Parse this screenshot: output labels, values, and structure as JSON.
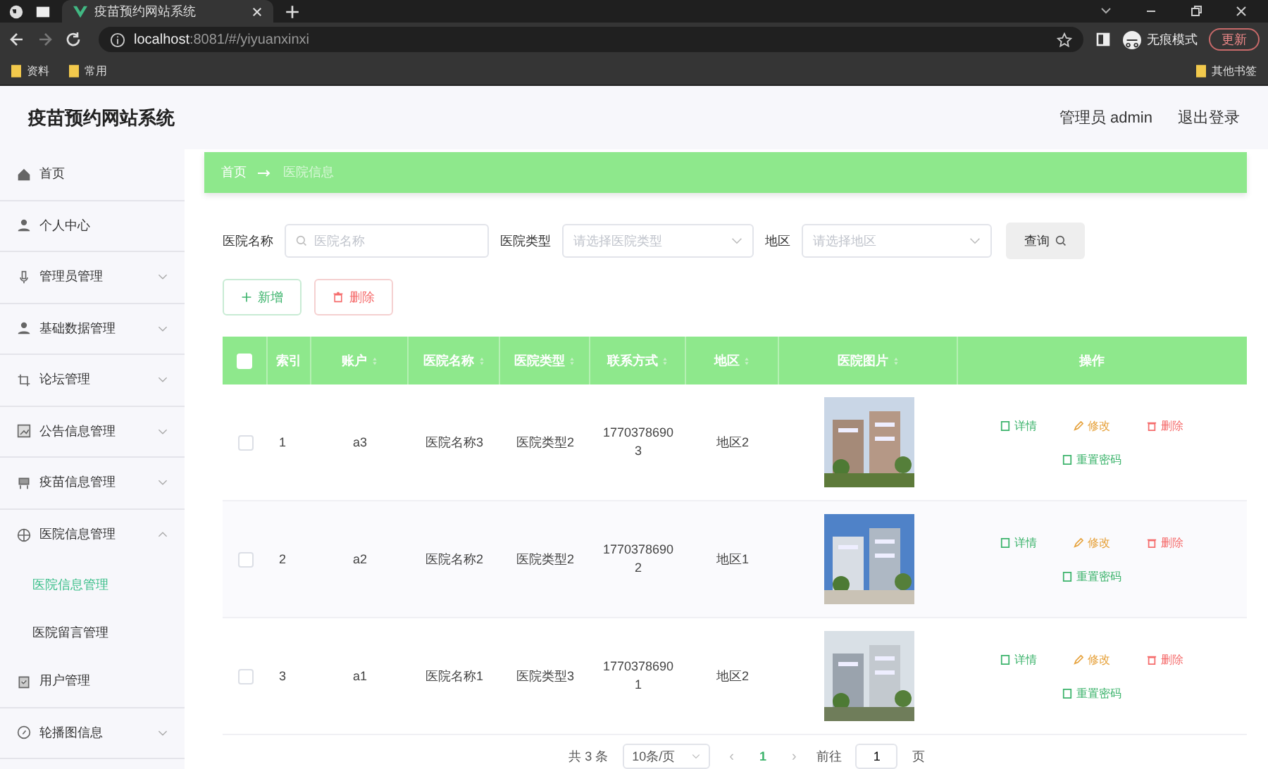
{
  "browser": {
    "tab_title": "疫苗预约网站系统",
    "url_host": "localhost",
    "url_rest": ":8081/#/yiyuanxinxi",
    "bookmarks": [
      "资料",
      "常用"
    ],
    "other_bookmarks": "其他书签",
    "incognito": "无痕模式",
    "update": "更新"
  },
  "header": {
    "title": "疫苗预约网站系统",
    "user": "管理员 admin",
    "logout": "退出登录"
  },
  "sidebar": {
    "items": [
      {
        "label": "首页",
        "kind": "link",
        "expanded": false
      },
      {
        "label": "个人中心",
        "kind": "link",
        "expanded": false
      },
      {
        "label": "管理员管理",
        "kind": "submenu",
        "expanded": false
      },
      {
        "label": "基础数据管理",
        "kind": "submenu",
        "expanded": false
      },
      {
        "label": "论坛管理",
        "kind": "submenu",
        "expanded": false
      },
      {
        "label": "公告信息管理",
        "kind": "submenu",
        "expanded": false
      },
      {
        "label": "疫苗信息管理",
        "kind": "submenu",
        "expanded": false
      },
      {
        "label": "医院信息管理",
        "kind": "submenu",
        "expanded": true,
        "children": [
          {
            "label": "医院信息管理",
            "selected": true
          },
          {
            "label": "医院留言管理",
            "selected": false
          }
        ]
      },
      {
        "label": "用户管理",
        "kind": "link",
        "expanded": false
      },
      {
        "label": "轮播图信息",
        "kind": "submenu",
        "expanded": false
      }
    ]
  },
  "breadcrumb": [
    "首页",
    "医院信息"
  ],
  "search": {
    "fields": [
      {
        "label": "医院名称",
        "placeholder": "医院名称",
        "kind": "text"
      },
      {
        "label": "医院类型",
        "placeholder": "请选择医院类型",
        "kind": "select"
      },
      {
        "label": "地区",
        "placeholder": "请选择地区",
        "kind": "select"
      }
    ],
    "button": "查询"
  },
  "actions": {
    "add": "新增",
    "delete": "删除"
  },
  "table": {
    "select_all_checked": false,
    "columns": [
      "索引",
      "账户",
      "医院名称",
      "医院类型",
      "联系方式",
      "地区",
      "医院图片",
      "操作"
    ],
    "rows": [
      {
        "index": "1",
        "account": "a3",
        "name": "医院名称3",
        "type": "医院类型2",
        "phone": "17703786903",
        "region": "地区2",
        "checked": false,
        "ops": [
          "详情",
          "修改",
          "删除",
          "重置密码"
        ]
      },
      {
        "index": "2",
        "account": "a2",
        "name": "医院名称2",
        "type": "医院类型2",
        "phone": "17703786902",
        "region": "地区1",
        "checked": false,
        "ops": [
          "详情",
          "修改",
          "删除",
          "重置密码"
        ]
      },
      {
        "index": "3",
        "account": "a1",
        "name": "医院名称1",
        "type": "医院类型3",
        "phone": "17703786901",
        "region": "地区2",
        "checked": false,
        "ops": [
          "详情",
          "修改",
          "删除",
          "重置密码"
        ]
      }
    ]
  },
  "pagination": {
    "total": "共 3 条",
    "page_size": "10条/页",
    "prev": "‹",
    "current": "1",
    "next": "›",
    "goto": "前往",
    "goto_value": "1",
    "page_unit": "页"
  }
}
